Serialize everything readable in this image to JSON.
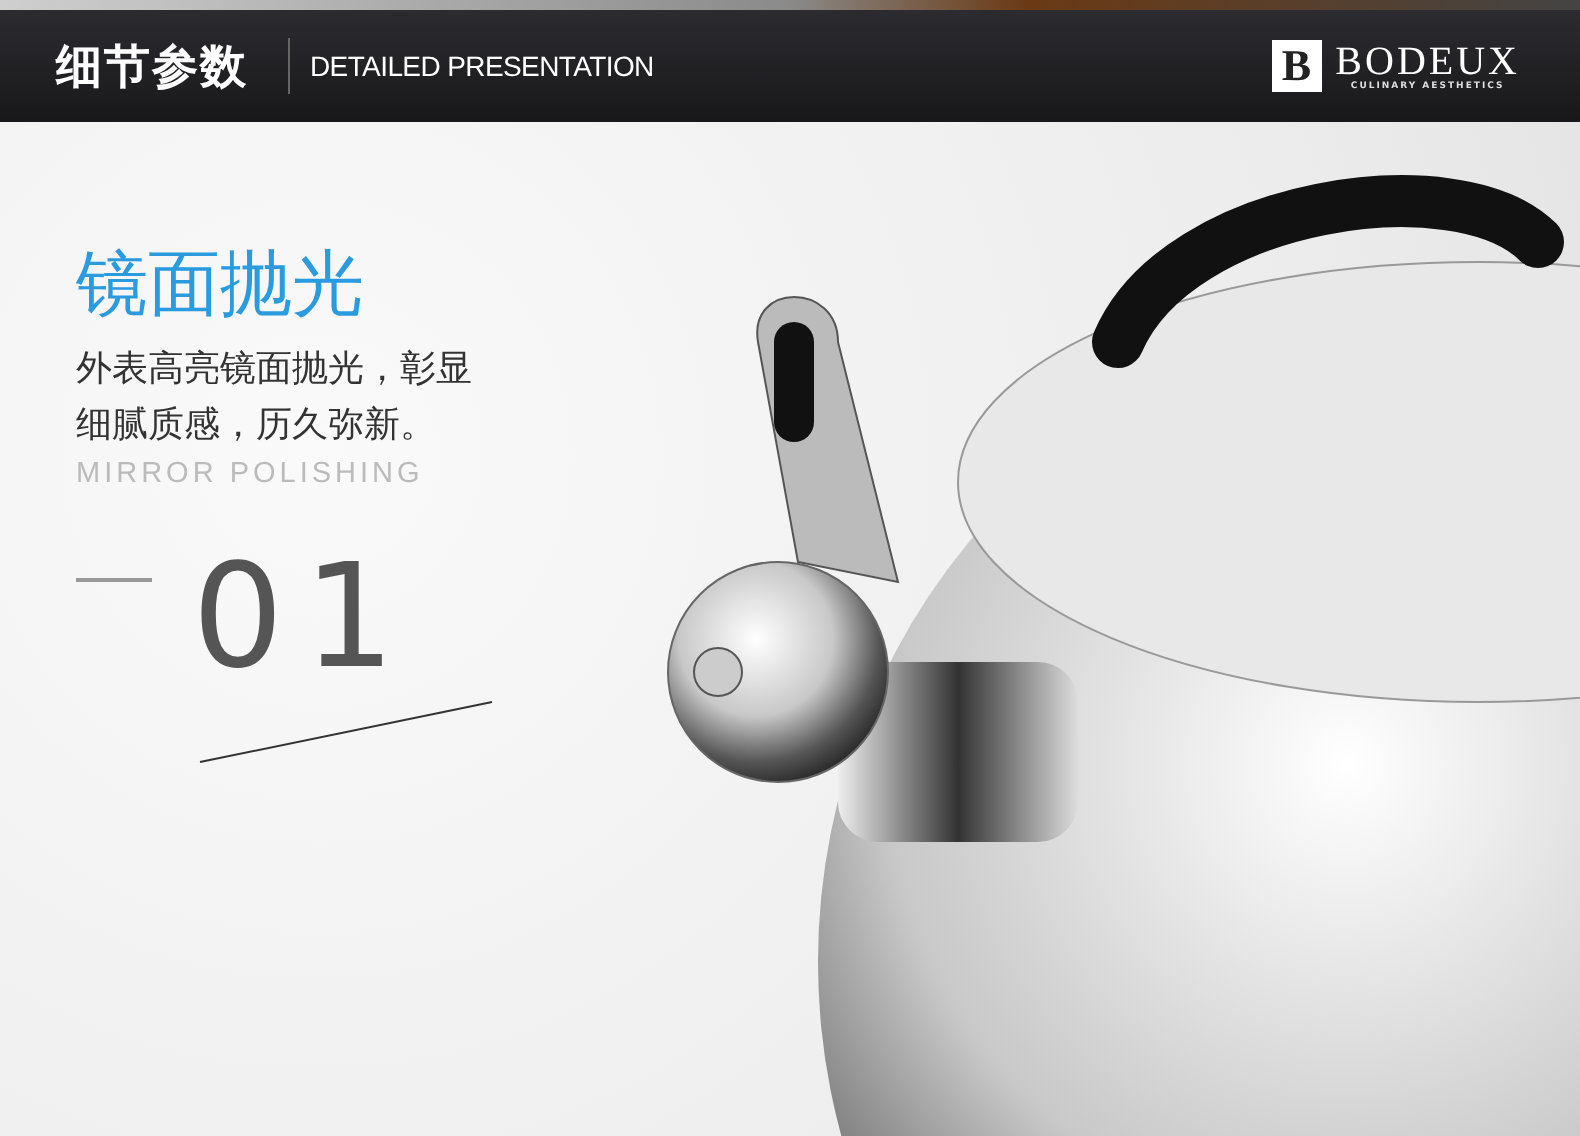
{
  "header": {
    "title": "细节参数",
    "subtitle": "DETAILED PRESENTATION",
    "logo": {
      "mark": "B",
      "name": "BODEUX",
      "tagline": "CULINARY AESTHETICS"
    }
  },
  "feature": {
    "heading": "镜面抛光",
    "description": "外表高亮镜面抛光，彰显细腻质感，历久弥新。",
    "english": "MIRROR POLISHING",
    "number": "01"
  }
}
